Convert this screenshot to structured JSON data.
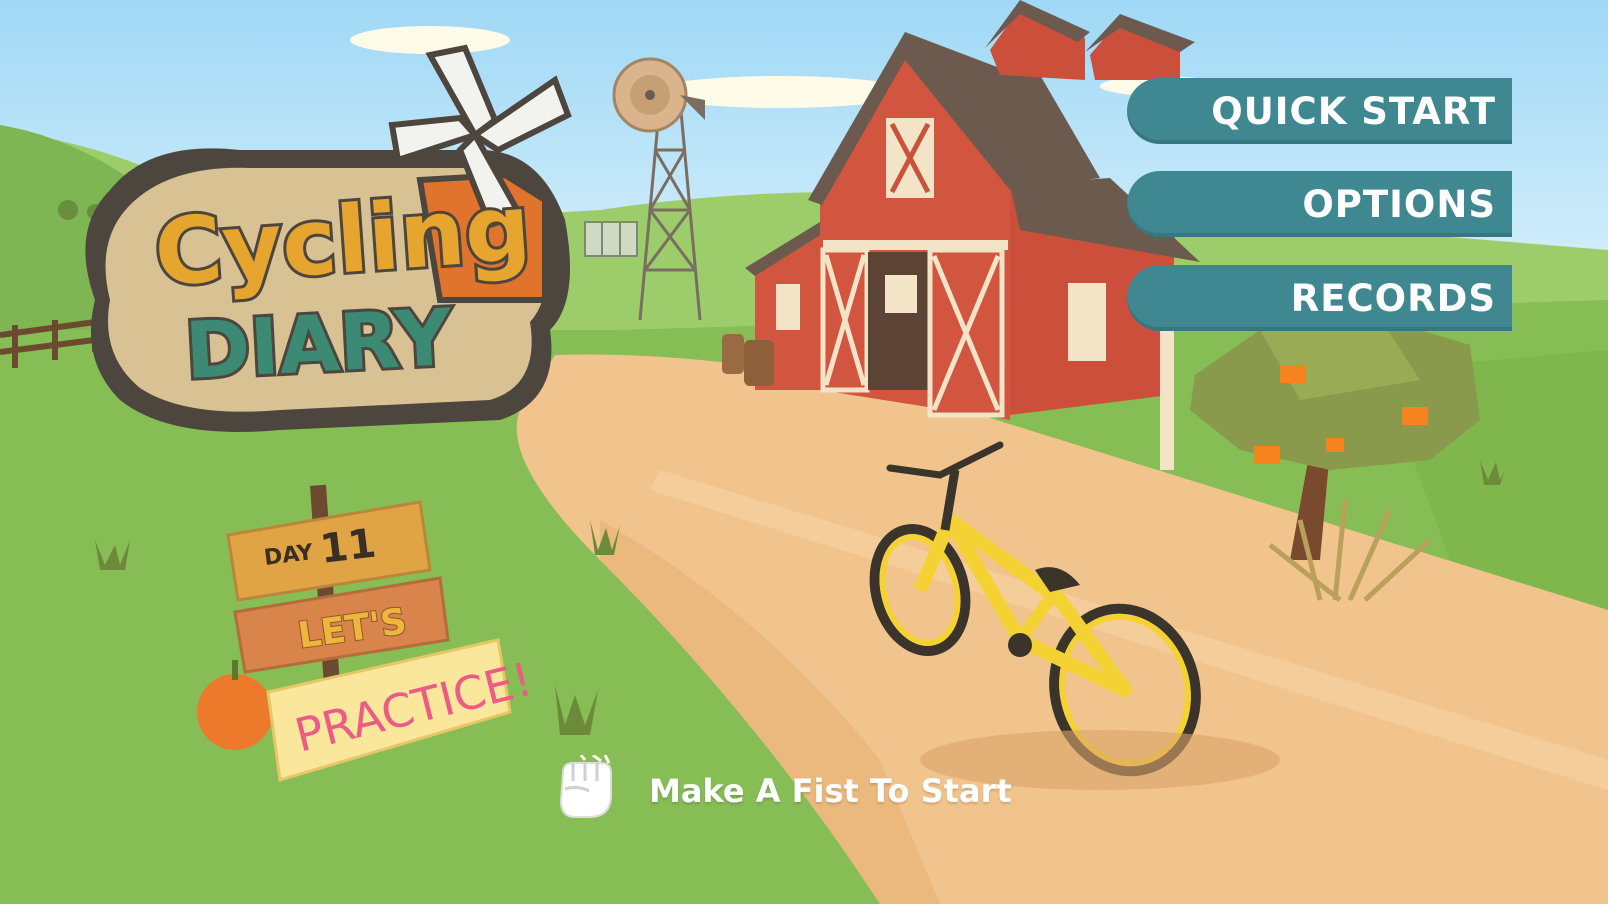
{
  "game": {
    "logo": {
      "line1": "Cycling",
      "line2": "DIARY"
    },
    "menu": [
      {
        "label": "QUICK START"
      },
      {
        "label": "OPTIONS"
      },
      {
        "label": "RECORDS"
      }
    ],
    "signpost": {
      "day_label": "DAY",
      "day_number": "11",
      "line2": "LET'S",
      "line3": "PRACTICE!"
    },
    "prompt": {
      "text": "Make A Fist To Start",
      "icon": "fist-icon"
    },
    "colors": {
      "sky": "#a9dcf7",
      "grass": "#86bd55",
      "road": "#f2c48d",
      "barn": "#d2553f",
      "menu_bg": "#3f8891",
      "bike": "#f5d233"
    }
  }
}
